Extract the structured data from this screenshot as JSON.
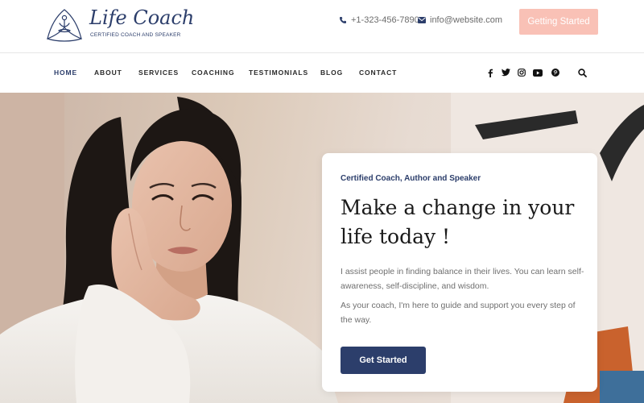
{
  "brand": {
    "title": "Life Coach",
    "tagline": "CERTIFIED COACH AND SPEAKER"
  },
  "header": {
    "phone": "+1-323-456-7890",
    "email": "info@website.com",
    "cta_label": "Getting Started"
  },
  "nav": {
    "items": [
      {
        "label": "HOME",
        "active": true
      },
      {
        "label": "ABOUT",
        "active": false
      },
      {
        "label": "SERVICES",
        "active": false
      },
      {
        "label": "COACHING",
        "active": false
      },
      {
        "label": "TESTIMONIALS",
        "active": false
      },
      {
        "label": "BLOG",
        "active": false
      },
      {
        "label": "CONTACT",
        "active": false
      }
    ],
    "social_icons": [
      "facebook-icon",
      "twitter-icon",
      "instagram-icon",
      "youtube-icon",
      "pinterest-icon"
    ],
    "search_icon": "search-icon"
  },
  "hero": {
    "eyebrow": "Certified Coach, Author and Speaker",
    "heading": "Make a change in your life today !",
    "paragraph1": "I assist people in finding balance in their lives. You can learn self-awareness, self-discipline, and wisdom.",
    "paragraph2": "As your coach, I'm here to guide and support you every step of the way.",
    "button_label": "Get Started"
  },
  "colors": {
    "brand_navy": "#2c3e6b",
    "accent_peach": "#f9c1b6",
    "text_dark": "#1a1a1a",
    "text_muted": "#6f6f6f"
  }
}
